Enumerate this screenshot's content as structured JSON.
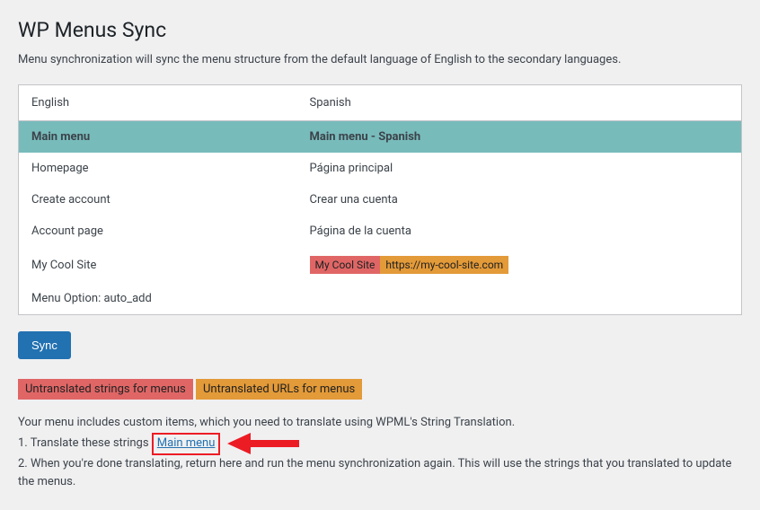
{
  "page": {
    "title": "WP Menus Sync",
    "intro": "Menu synchronization will sync the menu structure from the default language of English to the secondary languages."
  },
  "table": {
    "headers": {
      "col1": "English",
      "col2": "Spanish"
    },
    "menu_row": {
      "left": "Main menu",
      "right": "Main menu - Spanish"
    },
    "rows": [
      {
        "left": "Homepage",
        "right": "Página principal"
      },
      {
        "left": "Create account",
        "right": "Crear una cuenta"
      },
      {
        "left": "Account page",
        "right": "Página de la cuenta"
      }
    ],
    "custom_row": {
      "left": "My Cool Site",
      "right_label": "My Cool Site",
      "right_url": "https://my-cool-site.com"
    },
    "option_row": {
      "left": "Menu Option: auto_add"
    }
  },
  "buttons": {
    "sync": "Sync"
  },
  "legend": {
    "untranslated_strings": "Untranslated strings for menus",
    "untranslated_urls": "Untranslated URLs for menus"
  },
  "instructions": {
    "line0": "Your menu includes custom items, which you need to translate using WPML's String Translation.",
    "step1_prefix": "1. Translate these strings ",
    "step1_link": "Main menu",
    "step2": "2. When you're done translating, return here and run the menu synchronization again. This will use the strings that you translated to update the menus."
  }
}
